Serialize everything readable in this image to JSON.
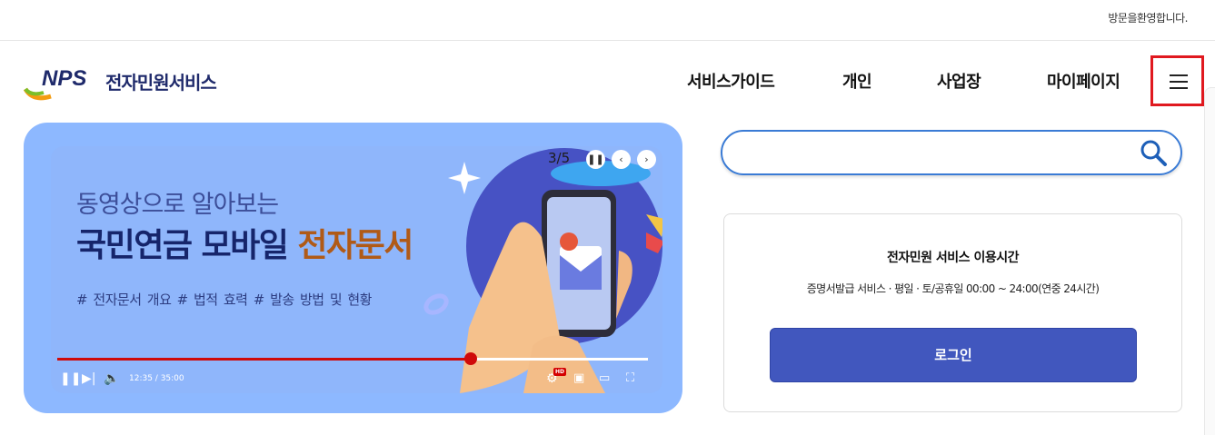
{
  "topbar": {
    "welcome": "방문을환영합니다."
  },
  "header": {
    "logo_text": "NPS",
    "site_name": "전자민원서비스",
    "nav": [
      "서비스가이드",
      "개인",
      "사업장",
      "마이페이지"
    ]
  },
  "banner": {
    "subtitle": "동영상으로 알아보는",
    "title_main": "국민연금 모바일 ",
    "title_highlight": "전자문서",
    "tags": "# 전자문서 개요  # 법적 효력  # 발송 방법 및 현황",
    "counter": "3/5",
    "video": {
      "time": "12:35 / 35:00",
      "progress": 0.7,
      "hd_badge": "HD"
    }
  },
  "search": {
    "placeholder": ""
  },
  "service_info": {
    "title": "전자민원 서비스 이용시간",
    "hours": "증명서발급 서비스 · 평일 · 토/공휴일 00:00 ~ 24:00(연중 24시간)",
    "login_label": "로그인"
  },
  "colors": {
    "accent": "#4157be",
    "brand_navy": "#1f2a6b",
    "highlight": "#e0191f"
  }
}
